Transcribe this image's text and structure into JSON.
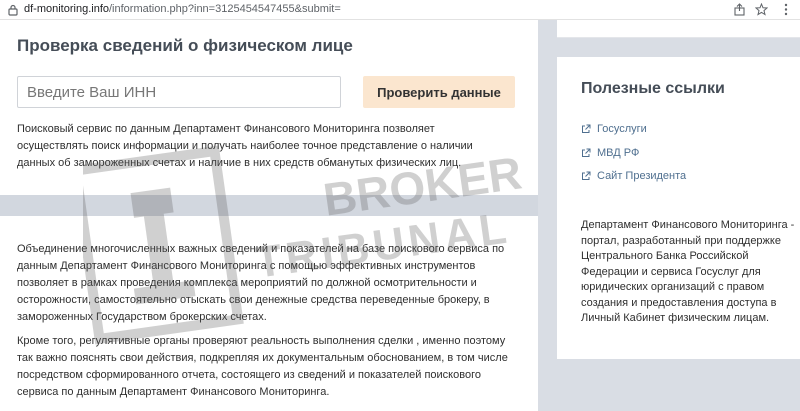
{
  "browser": {
    "url_host": "df-monitoring.info",
    "url_path": "/information.php?inn=3125454547455&submit="
  },
  "main": {
    "title": "Проверка сведений о физическом лице",
    "inn_placeholder": "Введите Ваш ИНН",
    "check_button": "Проверить данные",
    "intro": "Поисковый сервис по данным Департамент Финансового Мониторинга позволяет осуществлять поиск информации и получать наиболее точное представление о наличии данных об замороженных счетах и наличие в них средств обманутых физических лиц.",
    "union": "Объединение многочисленных важных сведений и показателей на базе поискового сервиса по данным Департамент Финансового Мониторинга с помощью эффективных инструментов позволяет в рамках проведения комплекса мероприятий по должной осмотрительности и осторожности, самостоятельно отыскать свои денежные средства переведенные брокеру, в замороженных Государством брокерских счетах.",
    "regulators": "Кроме того, регулятивные органы проверяют реальность выполнения сделки , именно поэтому так важно пояснять свои действия, подкрепляя их документальным обоснованием, в том числе посредством сформированного отчета, состоящего из сведений и показателей поискового сервиса по данным Департамент Финансового Мониторинга."
  },
  "sidebar": {
    "title": "Полезные ссылки",
    "links": [
      {
        "label": "Госуслуги"
      },
      {
        "label": "МВД РФ"
      },
      {
        "label": "Сайт Президента"
      }
    ],
    "description": "Департамент Финансового Мониторинга - портал, разработанный при поддержке Центрального Банка Российской Федерации и сервиса Госуслуг для юридических организаций с правом создания и предоставления доступа в Личный Кабинет физическим лицам."
  },
  "watermark": {
    "line1": "BROKER",
    "line2": "TRIBUNAL"
  },
  "colors": {
    "accent_button": "#fbe6cf",
    "link": "#4f6f8f",
    "page_background": "#d9dde4"
  }
}
